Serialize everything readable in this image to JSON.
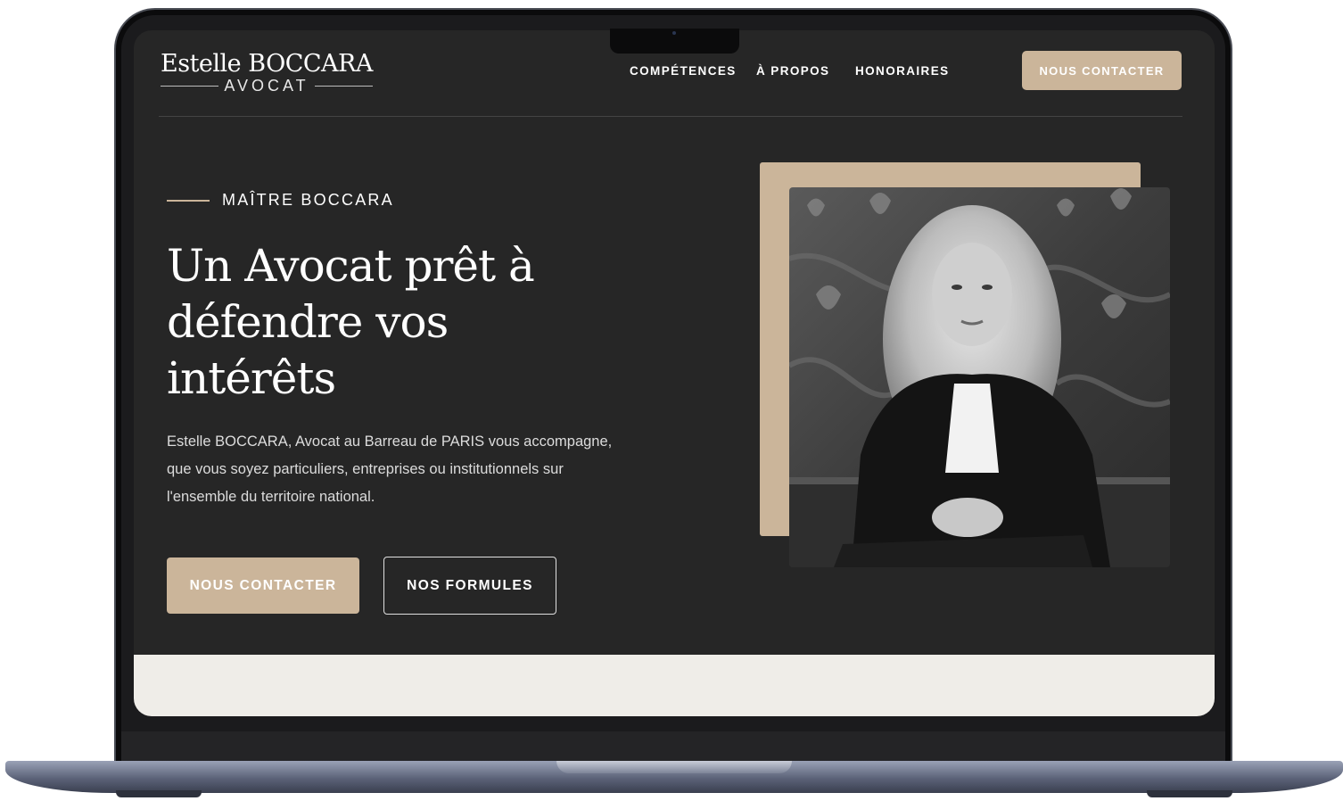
{
  "site": {
    "logo_name": "Estelle BOCCARA",
    "logo_sub": "AVOCAT"
  },
  "nav": {
    "items": [
      {
        "label": "COMPÉTENCES"
      },
      {
        "label": "À PROPOS"
      },
      {
        "label": "HONORAIRES"
      }
    ],
    "cta_label": "NOUS CONTACTER"
  },
  "hero": {
    "kicker": "MAÎTRE BOCCARA",
    "headline_line1": "Un Avocat prêt à",
    "headline_line2": "défendre vos",
    "headline_line3": "intérêts",
    "intro_line1": "Estelle BOCCARA, Avocat au Barreau de PARIS vous accompagne,",
    "intro_line2": "que vous soyez particuliers, entreprises ou institutionnels sur",
    "intro_line3": "l'ensemble du territoire national.",
    "primary_label": "NOUS CONTACTER",
    "secondary_label": "NOS FORMULES"
  },
  "colors": {
    "background": "#262626",
    "accent": "#cbb59a",
    "strip": "#efede8"
  },
  "icons": {
    "camera": "camera-dot-icon"
  }
}
